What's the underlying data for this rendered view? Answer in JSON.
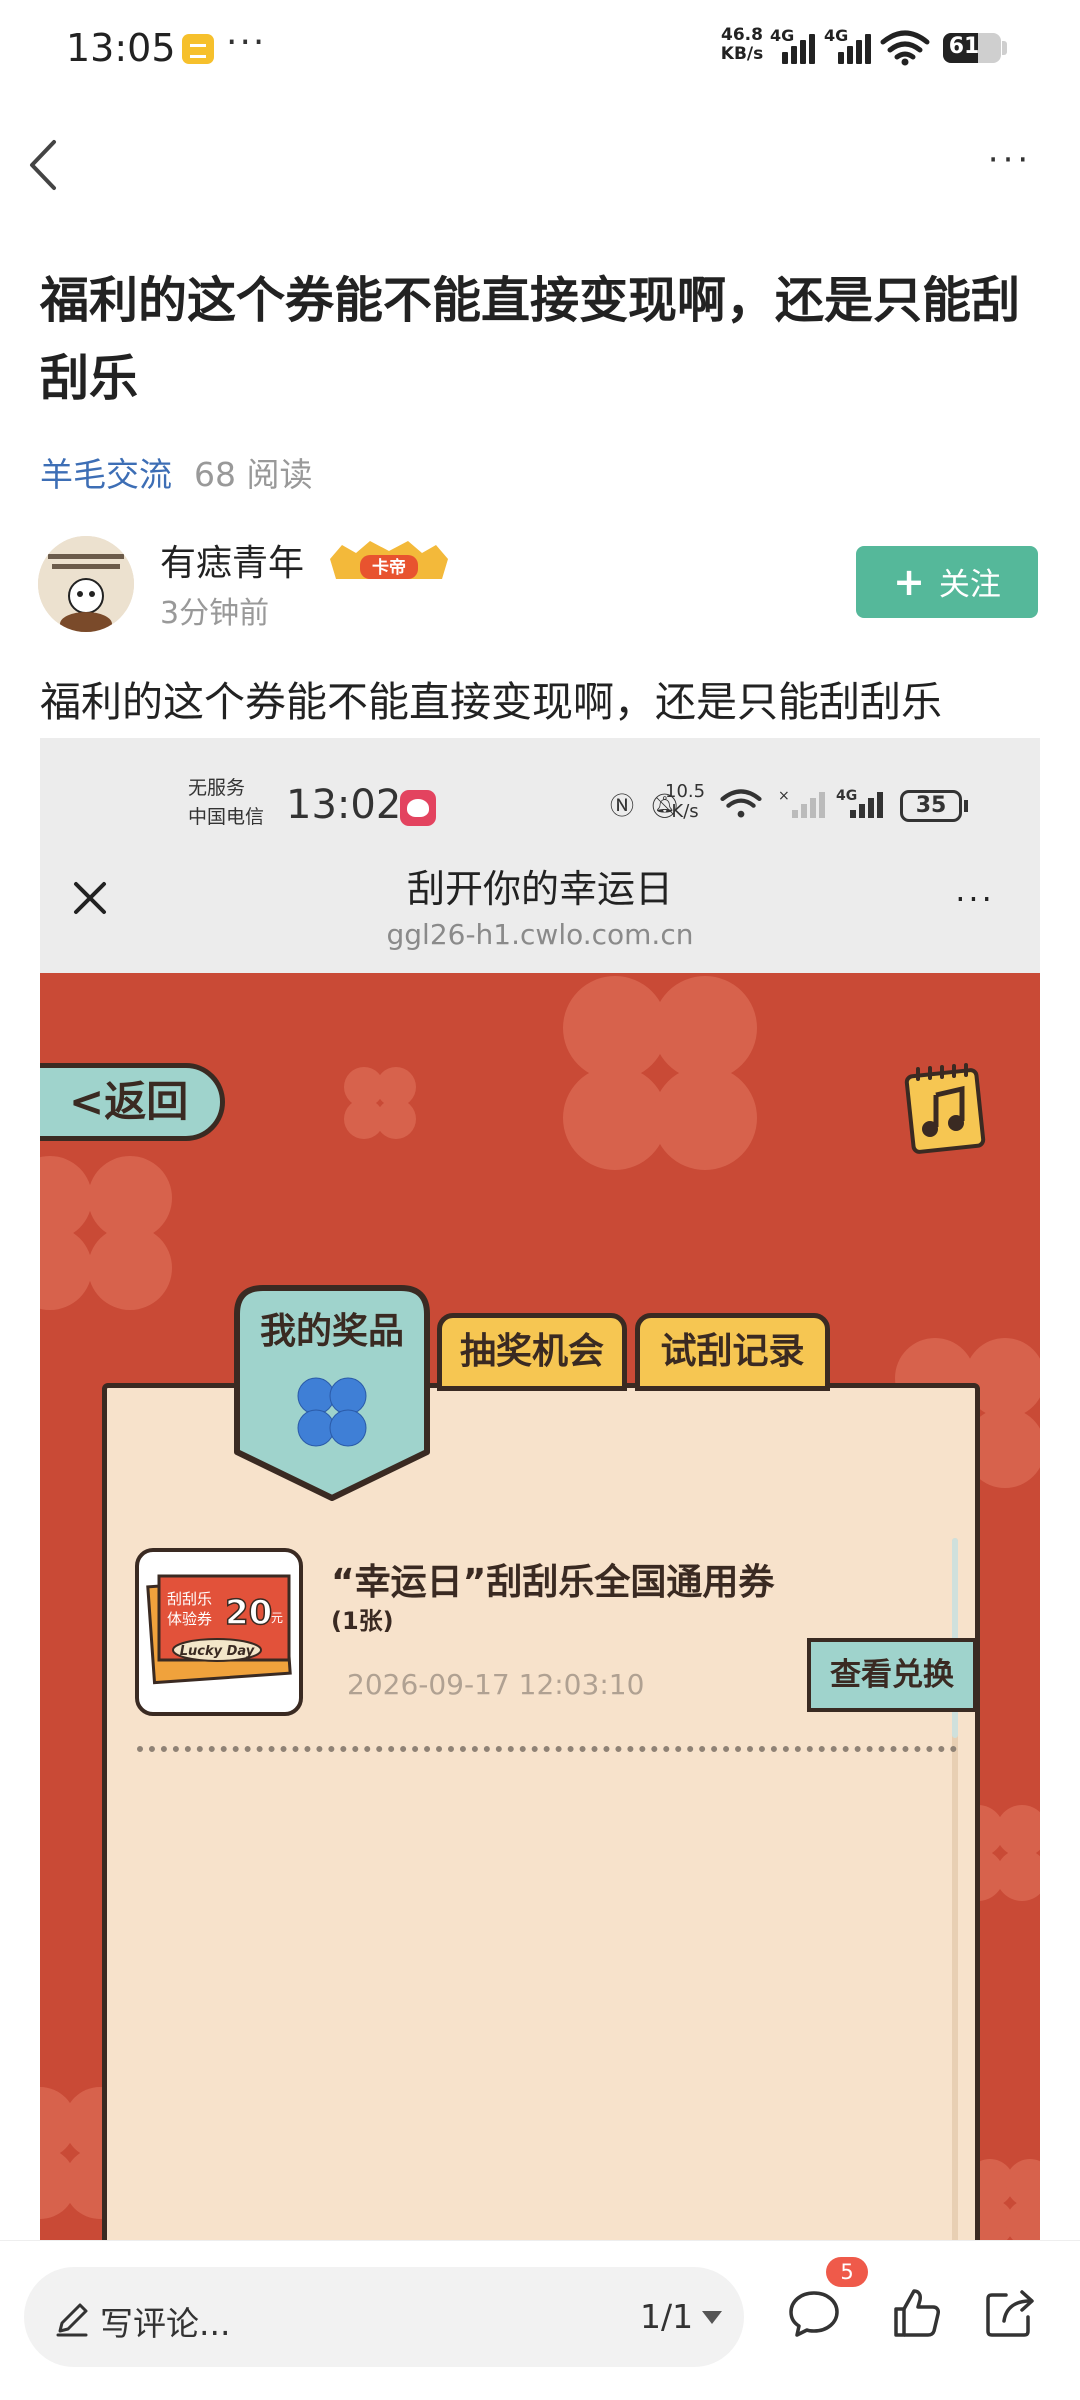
{
  "status_bar": {
    "time": "13:05",
    "net_speed_value": "46.8",
    "net_speed_unit": "KB/s",
    "sim1": "4G",
    "sim2": "4G",
    "battery": "61",
    "battery_level": 0.61
  },
  "post": {
    "title": "福利的这个券能不能直接变现啊，还是只能刮刮乐",
    "category": "羊毛交流",
    "reads": "68 阅读",
    "author": "有痣青年",
    "author_badge": "卡帝",
    "time_ago": "3分钟前",
    "follow_label": "关注",
    "body": "福利的这个券能不能直接变现啊，还是只能刮刮乐"
  },
  "screenshot": {
    "status": {
      "carrier_line1": "无服务",
      "carrier_line2": "中国电信",
      "time": "13:02",
      "speed_value": "10.5",
      "speed_unit": "K/s",
      "sim": "4G",
      "battery": "35"
    },
    "page_title": "刮开你的幸运日",
    "page_url": "ggl26-h1.cwlo.com.cn",
    "back_label": "<返回",
    "tabs": {
      "prizes": "我的奖品",
      "chances": "抽奖机会",
      "records": "试刮记录"
    },
    "prize": {
      "ticket_line1": "刮刮乐",
      "ticket_line2": "体验券",
      "ticket_value": "20",
      "ticket_unit": "元",
      "ticket_brand": "Lucky Day",
      "name": "“幸运日”刮刮乐全国通用券",
      "quantity": "(1张)",
      "redeem_label": "查看兑换",
      "time": "2026-09-17 12:03:10"
    }
  },
  "bottom_bar": {
    "comment_placeholder": "写评论...",
    "page_indicator": "1/1",
    "comment_count": "5"
  },
  "colors": {
    "accent_green": "#55b89a",
    "category_blue": "#3d6eb5",
    "game_red": "#c94a36",
    "panel_cream": "#f7e2cb",
    "tab_yellow": "#f6c652",
    "teal": "#9fd3cc",
    "badge_red": "#ef5a4a"
  }
}
